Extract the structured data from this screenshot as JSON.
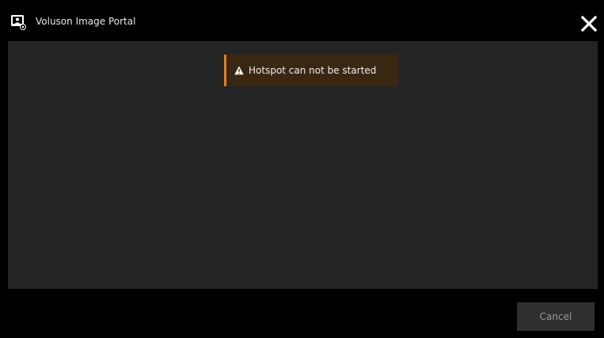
{
  "window": {
    "title": "Voluson Image Portal",
    "app_icon": "voluson-portal-icon",
    "close_icon": "close-icon"
  },
  "notification": {
    "icon": "warning-icon",
    "message": "Hotspot can not be started",
    "accent_color": "#e87e1f"
  },
  "footer": {
    "cancel_label": "Cancel"
  },
  "colors": {
    "titlebar": "#000000",
    "content_background": "#242424",
    "toast_background": "#3a2712",
    "button_background": "#2f2f2f"
  }
}
